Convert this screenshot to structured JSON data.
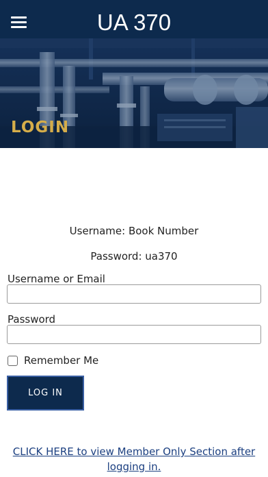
{
  "header": {
    "menu_icon": "hamburger-menu-icon",
    "title": "UA 370",
    "background_color": "#0d2a4d"
  },
  "hero": {
    "title": "LOGIN",
    "title_color": "#d5ad4a"
  },
  "credentials_hint": {
    "username_line": "Username: Book Number",
    "password_line": "Password: ua370"
  },
  "form": {
    "username_label": "Username or Email",
    "username_value": "",
    "password_label": "Password",
    "password_value": "",
    "remember_label": "Remember Me",
    "remember_checked": false,
    "submit_label": "LOG IN"
  },
  "footer_link": {
    "text": "CLICK HERE to view Member Only Section after logging in."
  },
  "colors": {
    "primary": "#0d2a4d",
    "accent": "#d5ad4a",
    "link": "#1b3f80"
  }
}
